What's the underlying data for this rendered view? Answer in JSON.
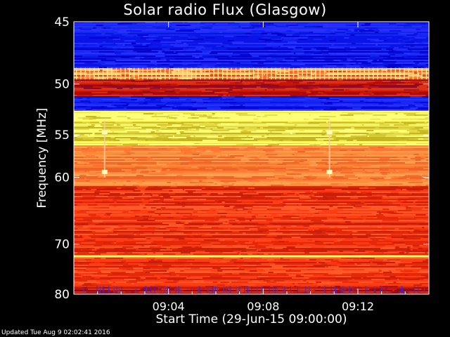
{
  "chart_data": {
    "type": "heatmap",
    "title": "Solar radio Flux (Glasgow)",
    "xlabel": "Start Time (29-Jun-15 09:00:00)",
    "ylabel": "Frequency [MHz]",
    "x_ticks": [
      "09:04",
      "09:08",
      "09:12"
    ],
    "x_tick_minutes": [
      4,
      8,
      12
    ],
    "xlim_minutes": [
      0,
      15
    ],
    "y_ticks": [
      45,
      50,
      55,
      60,
      70,
      80
    ],
    "ylim": [
      45,
      80
    ],
    "y_scale": "reciprocal",
    "colormap": "blue-red-yellow-white",
    "bands": [
      {
        "from": 44.5,
        "to": 48.6,
        "level": "low"
      },
      {
        "from": 48.6,
        "to": 49.5,
        "level": "high-banded"
      },
      {
        "from": 49.5,
        "to": 51.0,
        "level": "medium-low"
      },
      {
        "from": 51.0,
        "to": 52.5,
        "level": "low"
      },
      {
        "from": 52.5,
        "to": 56.0,
        "level": "very-high"
      },
      {
        "from": 56.0,
        "to": 61.0,
        "level": "high"
      },
      {
        "from": 61.0,
        "to": 78.0,
        "level": "medium"
      },
      {
        "from": 78.0,
        "to": 80.5,
        "level": "medium-low"
      }
    ],
    "bright_lines_mhz": [
      52.6,
      53.5,
      55.8,
      72.2
    ],
    "burst_minutes": [
      1.3,
      10.8
    ]
  },
  "footer": {
    "updated": "Updated Tue Aug  9 02:02:41 2016"
  },
  "colors": {
    "background": "#000000",
    "low": "#0a1ee6",
    "medium": "#e6280a",
    "high": "#ff8c3c",
    "very_high": "#ffff50"
  }
}
